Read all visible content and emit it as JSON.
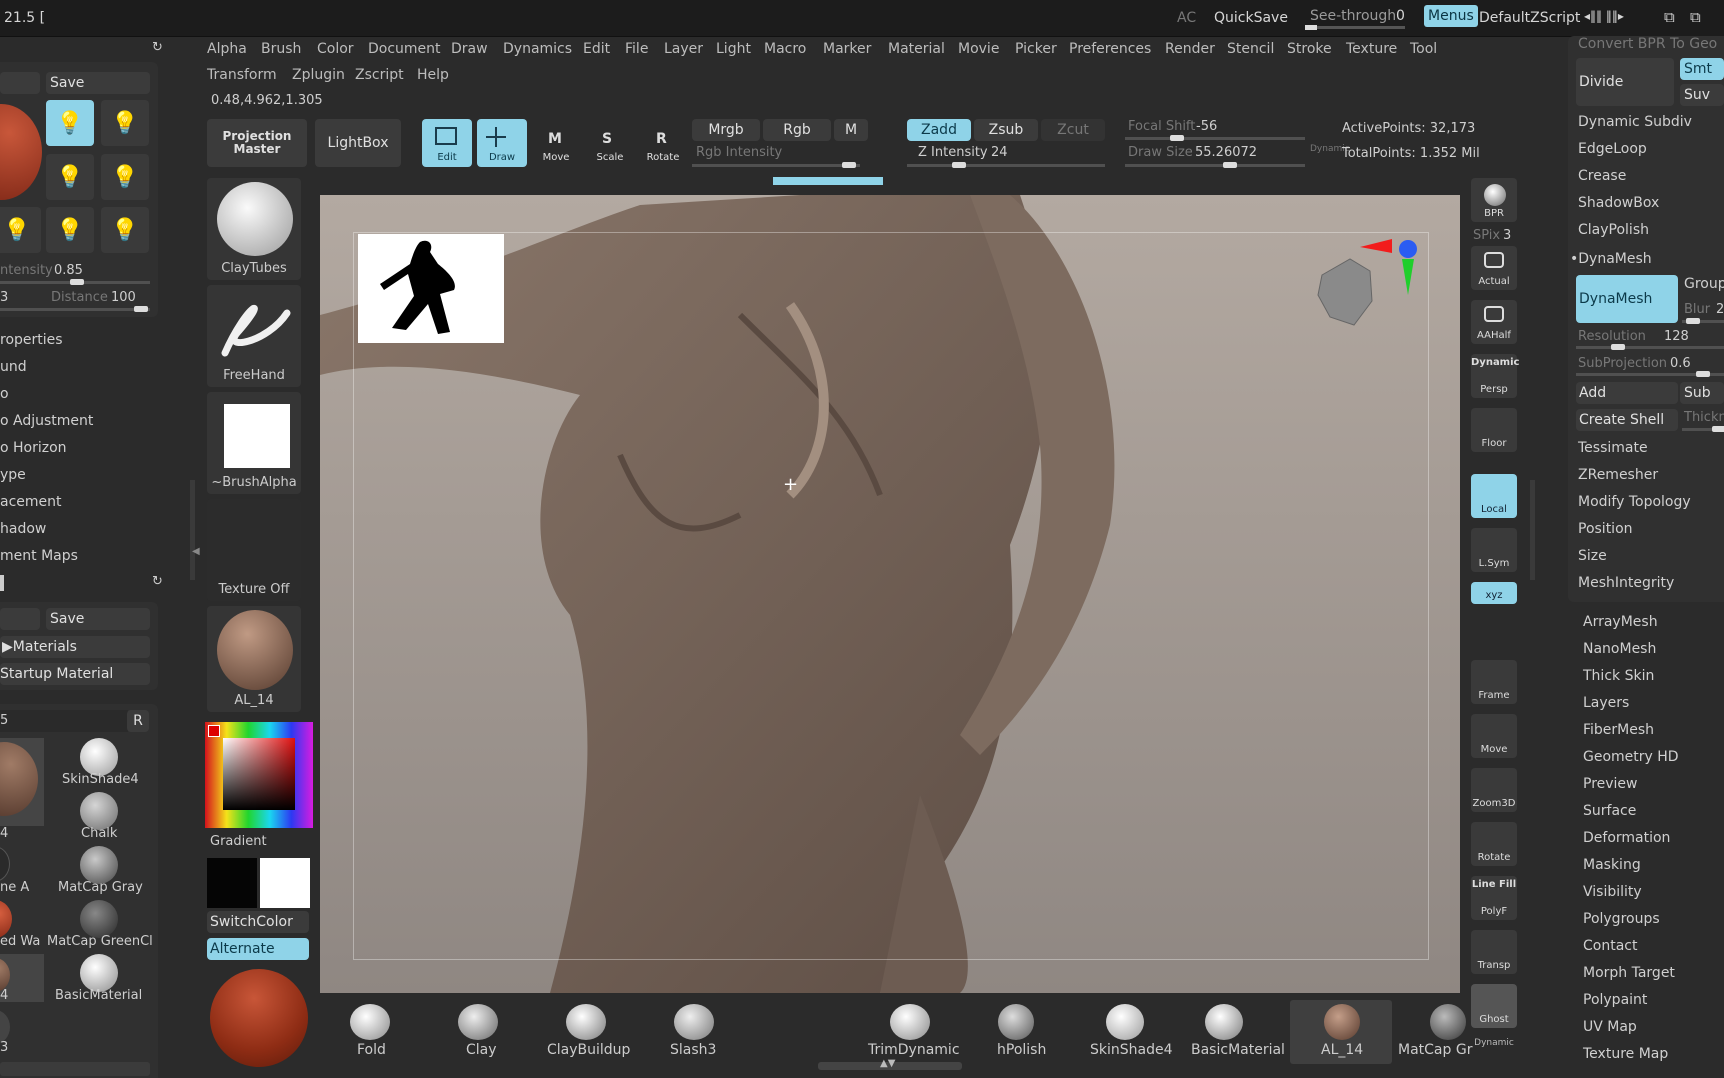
{
  "topbar": {
    "version": "21.5 [",
    "ac": "AC",
    "quicksave": "QuickSave",
    "see_through_label": "See-through",
    "see_through_value": "0",
    "menus": "Menus",
    "default_zscript": "DefaultZScript"
  },
  "menu_row1": [
    "Alpha",
    "Brush",
    "Color",
    "Document",
    "Draw",
    "Dynamics",
    "Edit",
    "File",
    "Layer",
    "Light",
    "Macro",
    "Marker",
    "Material",
    "Movie",
    "Picker",
    "Preferences",
    "Render",
    "Stencil",
    "Stroke",
    "Texture",
    "Tool"
  ],
  "menu_row2": [
    "Transform",
    "Zplugin",
    "Zscript",
    "Help"
  ],
  "coords": "0.48,4.962,1.305",
  "toolbar": {
    "projection_master": "Projection Master",
    "lightbox": "LightBox",
    "edit": "Edit",
    "draw": "Draw",
    "move": "Move",
    "scale": "Scale",
    "rotate": "Rotate",
    "mrgb": "Mrgb",
    "rgb": "Rgb",
    "m": "M",
    "rgb_intensity": "Rgb Intensity",
    "zadd": "Zadd",
    "zsub": "Zsub",
    "zcut": "Zcut",
    "z_intensity_label": "Z Intensity",
    "z_intensity_value": "24",
    "focal_shift_label": "Focal Shift",
    "focal_shift_value": "-56",
    "draw_size_label": "Draw Size",
    "draw_size_value": "55.26072",
    "dynamic": "Dynamic",
    "active_points": "ActivePoints: 32,173",
    "total_points": "TotalPoints: 1.352 Mil"
  },
  "left_panel": {
    "save": "Save",
    "intensity_label": "ntensity",
    "intensity_value": "0.85",
    "distance_label": "Distance",
    "distance_value": "100",
    "num_3": "3",
    "items": [
      "roperties",
      "und",
      "o",
      "o Adjustment",
      "o Horizon",
      "ype",
      "acement",
      "hadow",
      "ment Maps"
    ],
    "save2": "Save",
    "materials": "Materials",
    "startup_material": "Startup Material",
    "field_value": "5",
    "r_button": "R",
    "materials_list": [
      {
        "name": "SkinShade4"
      },
      {
        "name": "Chalk"
      },
      {
        "name": "MatCap Gray"
      },
      {
        "name": "MatCap GreenCl"
      },
      {
        "name": "BasicMaterial"
      }
    ],
    "left_fragments": [
      "4",
      "ne A",
      "ed Wa",
      "4",
      "3"
    ]
  },
  "brush_column": {
    "claytubes": "ClayTubes",
    "freehand": "FreeHand",
    "brushalpha": "~BrushAlpha",
    "texture_off": "Texture Off",
    "al14": "AL_14",
    "gradient": "Gradient",
    "switchcolor": "SwitchColor",
    "alternate": "Alternate"
  },
  "right_tools": {
    "bpr": "BPR",
    "spix_label": "SPix",
    "spix_value": "3",
    "actual": "Actual",
    "aahalf": "AAHalf",
    "dynamic": "Dynamic",
    "persp": "Persp",
    "floor": "Floor",
    "local": "Local",
    "lsym": "L.Sym",
    "xyz": "xyz",
    "frame": "Frame",
    "move": "Move",
    "zoom3d": "Zoom3D",
    "rotate": "Rotate",
    "line_fill": "Line Fill",
    "polyf": "PolyF",
    "transp": "Transp",
    "ghost": "Ghost",
    "dynamic2": "Dynamic"
  },
  "geometry_panel": {
    "convert_bpr": "Convert BPR To Geo",
    "divide": "Divide",
    "smt": "Smt",
    "suv": "Suv",
    "dynamic_subdiv": "Dynamic Subdiv",
    "edgeloop": "EdgeLoop",
    "crease": "Crease",
    "shadowbox": "ShadowBox",
    "claypolish": "ClayPolish",
    "dynamesh_header": "DynaMesh",
    "dynamesh_btn": "DynaMesh",
    "groups": "Groups",
    "blur_label": "Blur",
    "blur_value": "2",
    "resolution_label": "Resolution",
    "resolution_value": "128",
    "subprojection_label": "SubProjection",
    "subprojection_value": "0.6",
    "add": "Add",
    "sub": "Sub",
    "create_shell": "Create Shell",
    "thickness": "Thickn",
    "tessimate": "Tessimate",
    "zremesher": "ZRemesher",
    "modify_topology": "Modify Topology",
    "position": "Position",
    "size": "Size",
    "meshintegrity": "MeshIntegrity",
    "list": [
      "ArrayMesh",
      "NanoMesh",
      "Thick Skin",
      "Layers",
      "FiberMesh",
      "Geometry HD",
      "Preview",
      "Surface",
      "Deformation",
      "Masking",
      "Visibility",
      "Polygroups",
      "Contact",
      "Morph Target",
      "Polypaint",
      "UV Map",
      "Texture Map"
    ]
  },
  "bottom_shelf": [
    "Fold",
    "Clay",
    "ClayBuildup",
    "Slash3",
    "TrimDynamic",
    "hPolish",
    "SkinShade4",
    "BasicMaterial",
    "AL_14",
    "MatCap Gr"
  ],
  "colors": {
    "accent": "#8fd3e8",
    "canvas_top": "#b1a79f",
    "canvas_bottom": "#8c8580",
    "skin": "#7e6a5e",
    "red_sphere": "#a2391f"
  }
}
